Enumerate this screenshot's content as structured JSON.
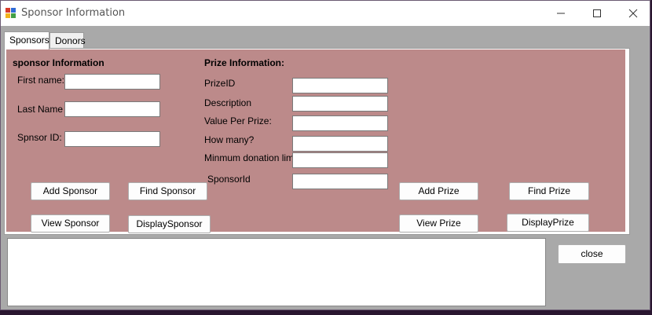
{
  "window": {
    "title": "Sponsor Information"
  },
  "tabs": [
    {
      "label": "Sponsors"
    },
    {
      "label": "Donors"
    }
  ],
  "sponsor": {
    "header": "sponsor Information",
    "first_name_label": "First name:",
    "last_name_label": "Last Name",
    "sponsor_id_label": "Spnsor ID:",
    "first_name_value": "",
    "last_name_value": "",
    "sponsor_id_value": ""
  },
  "prize": {
    "header": "Prize Information:",
    "prize_id_label": "PrizeID",
    "description_label": "Description",
    "value_per_prize_label": "Value Per Prize:",
    "how_many_label": "How many?",
    "min_donation_label": "Minmum donation limit",
    "sponsor_id_label": "SponsorId"
  },
  "buttons": {
    "add_sponsor": "Add Sponsor",
    "find_sponsor": "Find Sponsor",
    "view_sponsor": "View Sponsor",
    "display_sponsor": "DisplaySponsor",
    "add_prize": "Add Prize",
    "find_prize": "Find Prize",
    "view_prize": "View Prize",
    "display_prize": "DisplayPrize",
    "close": "close"
  },
  "output": {
    "text": ""
  },
  "colors": {
    "panel": "#bc8a8a",
    "window_bg": "#a9a9a9",
    "titlebar": "#ffffff",
    "desktop": "#2a1630"
  },
  "icons": {
    "app": "app-form-icon",
    "minimize": "minimize-icon",
    "maximize": "maximize-icon",
    "close": "close-icon"
  }
}
